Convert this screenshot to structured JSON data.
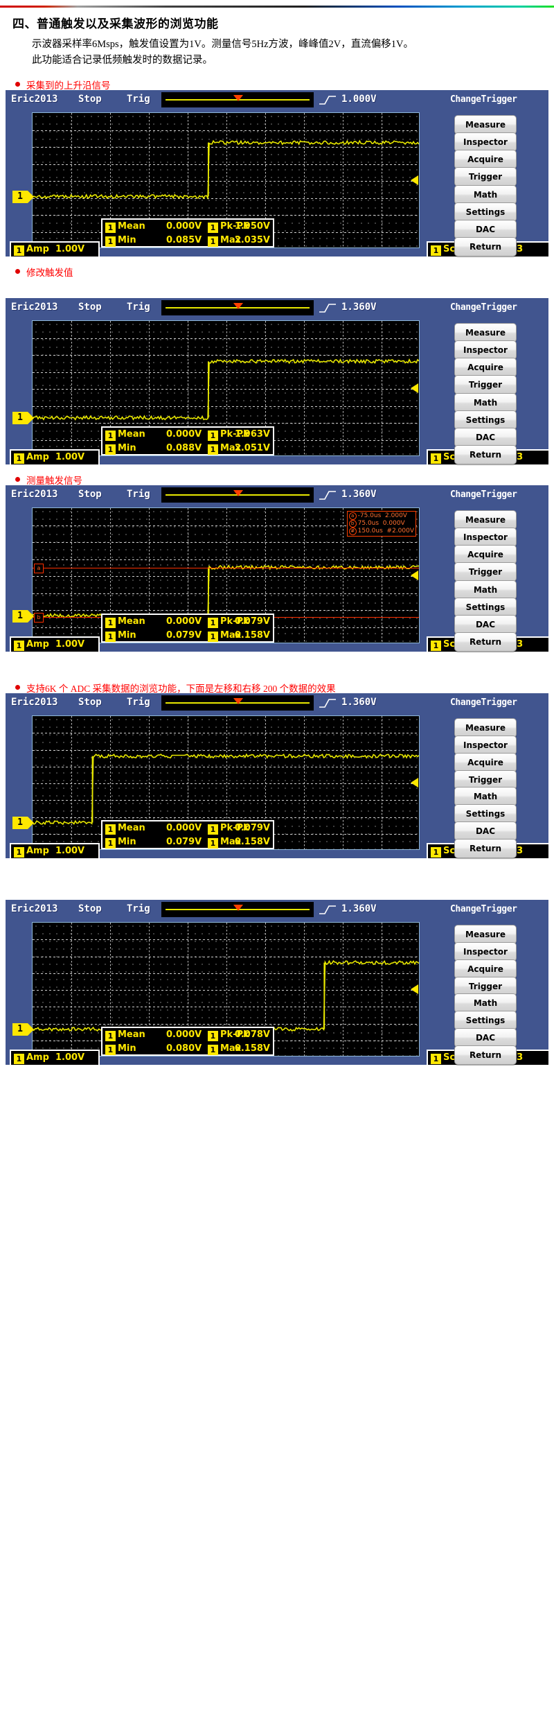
{
  "doc": {
    "section_title": "四、普通触发以及采集波形的浏览功能",
    "para1": "示波器采样率6Msps，触发值设置为1V。测量信号5Hz方波，峰峰值2V，直流偏移1V。",
    "para2": "此功能适合记录低频触发时的数据记录。"
  },
  "bullets": [
    "采集到的上升沿信号",
    "修改触发值",
    "测量触发信号",
    "支持6K 个 ADC 采集数据的浏览功能，下面是左移和右移 200 个数据的效果"
  ],
  "common": {
    "device": "Eric2013",
    "run_state": "Stop",
    "trig_label": "Trig",
    "brand": "ChangeTrigger",
    "edge_icon": "rising-edge-icon",
    "buttons": [
      "Measure",
      "Inspector",
      "Acquire",
      "Trigger",
      "Math",
      "Settings",
      "DAC",
      "Return"
    ],
    "amp_label": "Amp",
    "amp_value": "1.00V",
    "scale_label": "Scale",
    "scale_value": "500ns / 3",
    "ch_tag": "1",
    "mean_label": "Mean",
    "pkpk_label": "Pk-Pk",
    "min_label": "Min",
    "max_label": "Max",
    "colors": {
      "panel_blue": "#41558f",
      "trace_yellow": "#e8e800",
      "cursor_red": "#ff3000",
      "plot_bg": "#000000",
      "bullet_red": "#ff0000"
    }
  },
  "panels": [
    {
      "id": "panel-1",
      "trig_level": "1.000V",
      "measure": {
        "mean": "0.000V",
        "pkpk": "1.950V",
        "min": "0.085V",
        "max": "2.035V"
      },
      "amp": "1.00V",
      "scale": "500ns / 3",
      "waveform": {
        "low_y": 0.62,
        "high_y": 0.22,
        "edge_x": 0.455,
        "noise": 0.012
      },
      "cursors": null
    },
    {
      "id": "panel-2",
      "trig_level": "1.360V",
      "measure": {
        "mean": "0.000V",
        "pkpk": "1.963V",
        "min": "0.088V",
        "max": "2.051V"
      },
      "amp": "1.00V",
      "scale": "500ns / 3",
      "waveform": {
        "low_y": 0.72,
        "high_y": 0.3,
        "edge_x": 0.455,
        "noise": 0.012
      },
      "cursors": null
    },
    {
      "id": "panel-3",
      "trig_level": "1.360V",
      "measure": {
        "mean": "0.000V",
        "pkpk": "0.079V",
        "min": "0.079V",
        "max": "0.158V"
      },
      "amp": "1.00V",
      "scale": "500ns / 3",
      "waveform": {
        "low_y": 0.8,
        "high_y": 0.44,
        "edge_x": 0.455,
        "noise": 0.012
      },
      "cursors": {
        "rows": [
          {
            "badge": "a",
            "time": "-75.0us",
            "value": "2.000V"
          },
          {
            "badge": "b",
            "time": "75.0us",
            "value": "0.000V"
          },
          {
            "badge": "#",
            "time": "150.0us",
            "value": "#2.000V"
          }
        ],
        "line_a_y": 0.44,
        "line_b_y": 0.8
      }
    },
    {
      "id": "panel-4",
      "trig_level": "1.360V",
      "measure": {
        "mean": "0.000V",
        "pkpk": "0.079V",
        "min": "0.079V",
        "max": "0.158V"
      },
      "amp": "1.00V",
      "scale": "500ns / 3",
      "waveform": {
        "low_y": 0.8,
        "high_y": 0.3,
        "edge_x": 0.155,
        "noise": 0.012
      },
      "cursors": null
    },
    {
      "id": "panel-5",
      "trig_level": "1.360V",
      "measure": {
        "mean": "0.000V",
        "pkpk": "0.078V",
        "min": "0.080V",
        "max": "0.158V"
      },
      "amp": "1.00V",
      "scale": "500ns / 3",
      "waveform": {
        "low_y": 0.8,
        "high_y": 0.3,
        "edge_x": 0.755,
        "noise": 0.012
      },
      "cursors": null
    }
  ]
}
